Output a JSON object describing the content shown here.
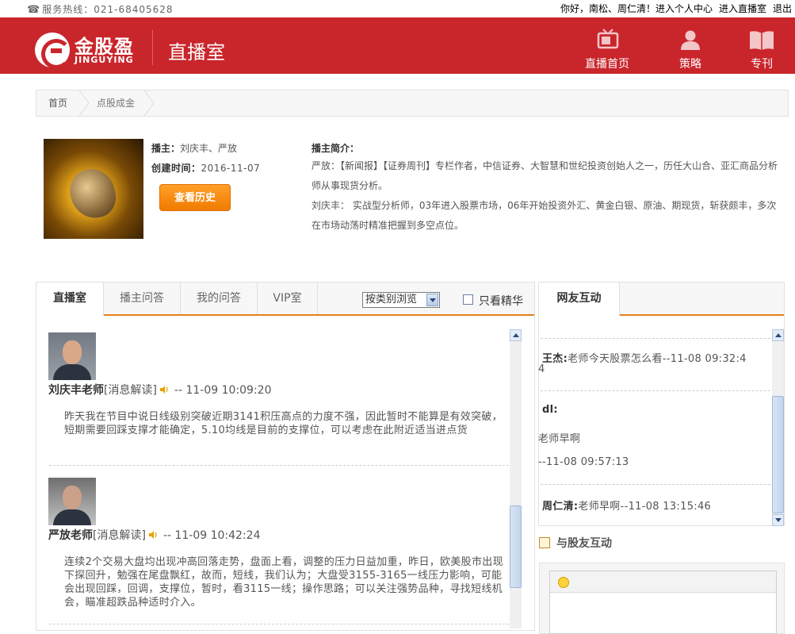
{
  "topbar": {
    "hotline_label": "服务热线：",
    "hotline_number": "021-68405628",
    "greeting": "你好，南松、周仁清！",
    "personal_center": "进入个人中心",
    "enter_live": "进入直播室",
    "logout": "退出"
  },
  "header": {
    "logo_cn": "金股盈",
    "logo_en": "JINGUYING",
    "section_title": "直播室",
    "nav": [
      {
        "label": "直播首页",
        "icon": "tv-icon"
      },
      {
        "label": "策略",
        "icon": "user-icon"
      },
      {
        "label": "专刊",
        "icon": "book-icon"
      }
    ]
  },
  "breadcrumb": [
    "首页",
    "点股成金"
  ],
  "anchor": {
    "host_label": "播主：",
    "host_value": "刘庆丰、严放",
    "created_label": "创建时间：",
    "created_value": "2016-11-07",
    "history_button": "查看历史",
    "intro_title": "播主简介：",
    "intro_1": "严放：【新闻报】【证券周刊】专栏作者，中信证券、大智慧和世纪投资创始人之一，历任大山合、亚汇商品分析师从事现货分析。",
    "intro_2": "刘庆丰： 实战型分析师，03年进入股票市场，06年开始投资外汇、黄金白银、原油、期现货，斩获颇丰，多次在市场动荡时精准把握到多空点位。"
  },
  "tabs": [
    "直播室",
    "播主问答",
    "我的问答",
    "VIP室"
  ],
  "filter": {
    "select_value": "按类别浏览",
    "only_featured": "只看精华"
  },
  "messages": [
    {
      "author": "刘庆丰老师",
      "category": "[消息解读]",
      "time": "-- 11-09 10:09:20",
      "text": "昨天我在节目中说日线级别突破近期3141积压高点的力度不强，因此暂时不能算是有效突破，短期需要回踩支撑才能确定，5.10均线是目前的支撑位，可以考虑在此附近适当进点货"
    },
    {
      "author": "严放老师",
      "category": "[消息解读]",
      "time": "-- 11-09 10:42:24",
      "text": "连续2个交易大盘均出现冲高回落走势，盘面上看，调整的压力日益加重，昨日，欧美股市出现下探回升，勉强在尾盘飘红，故而，短线，我们认为；大盘受3155-3165一线压力影响，可能会出现回踩，回调，支撑位，暂时，看3115一线；操作思路；可以关注强势品种，寻找短线机会，瞄准超跌品种适时介入。"
    }
  ],
  "community": {
    "tab": "网友互动",
    "chats": [
      {
        "name": "王杰:",
        "line1": "老师今天股票怎么看--11-08 09:32:4",
        "line2": "4"
      },
      {
        "name": "dl:",
        "content": "老师早啊",
        "time": "--11-08 09:57:13"
      },
      {
        "name": "周仁清:",
        "line1": "老师早啊--11-08 13:15:46"
      }
    ],
    "interact_title": "与股友互动"
  }
}
